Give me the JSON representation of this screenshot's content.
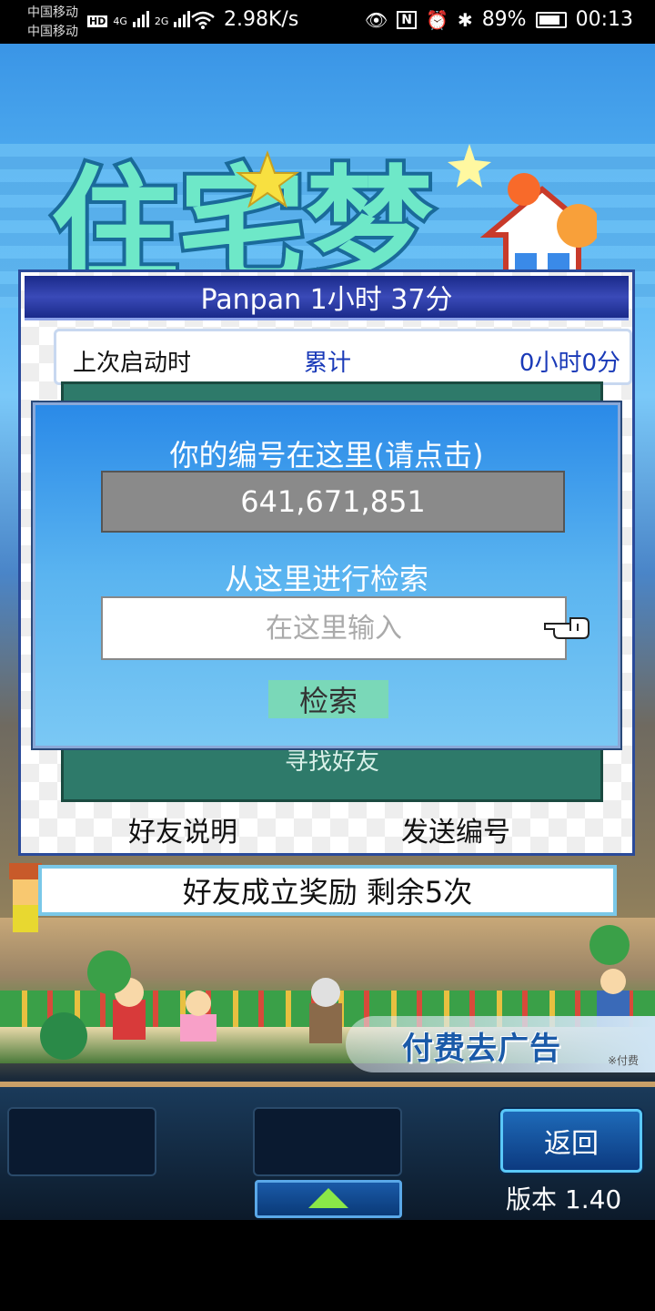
{
  "status_bar": {
    "carrier1": "中国移动",
    "carrier2": "中国移动",
    "network_tags": [
      "HD",
      "4G",
      "2G"
    ],
    "speed": "2.98K/s",
    "battery": "89%",
    "time": "00:13"
  },
  "game": {
    "logo_text": "住宅梦",
    "panel": {
      "header": "Panpan  1小时 37分",
      "last_launch_label": "上次启动时",
      "cumulative_label": "累计",
      "cumulative_time": "0小时0分",
      "find_friend": "寻找好友",
      "friend_help": "好友说明",
      "send_id": "发送编号"
    },
    "popup": {
      "title": "你的编号在这里(请点击)",
      "id_value": "641,671,851",
      "search_label": "从这里进行检索",
      "search_placeholder": "在这里输入",
      "search_button": "检索"
    },
    "bonus_bar": "好友成立奖励  剩余5次",
    "ad_banner": {
      "text": "付费去广告",
      "note": "※付费"
    },
    "controls": {
      "back_button": "返回",
      "version": "版本 1.40"
    }
  }
}
